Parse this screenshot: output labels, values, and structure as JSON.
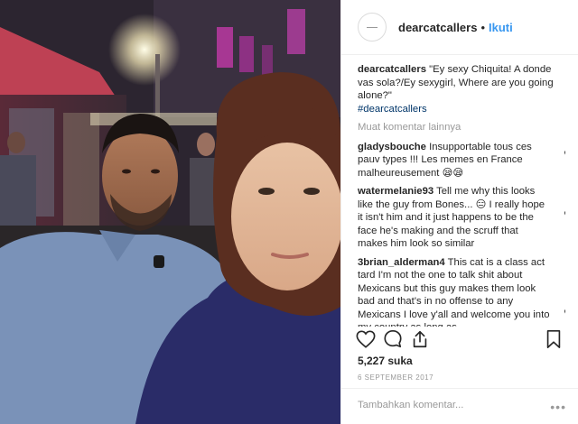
{
  "header": {
    "username": "dearcatcallers",
    "separator": "•",
    "follow_label": "Ikuti"
  },
  "caption": {
    "username": "dearcatcallers",
    "text": "\"Ey sexy Chiquita! A donde vas sola?/Ey sexygirl, Where are you going alone?\"",
    "hashtag": "#dearcatcallers"
  },
  "load_more_label": "Muat komentar lainnya",
  "comments": [
    {
      "username": "gladysbouche",
      "text": "Insupportable tous ces pauv types !!! Les memes en France malheureusement 😪😪"
    },
    {
      "username": "watermelanie93",
      "text": "Tell me why this looks like the guy from Bones... 😑 I really hope it isn't him and it just happens to be the face he's making and the scruff that makes him look so similar"
    },
    {
      "username": "3brian_alderman4",
      "text": "This cat is a class act tard I'm not the one to talk shit about Mexicans but this guy makes them look bad and that's in no offense to any Mexicans I love y'all and welcome you into my country as long as"
    }
  ],
  "icons": {
    "like": "heart-icon",
    "comment": "comment-icon",
    "share": "share-icon",
    "save": "bookmark-icon"
  },
  "likes_text": "5,227 suka",
  "date_text": "6 SEPTEMBER 2017",
  "add_comment": {
    "placeholder": "Tambahkan komentar...",
    "more_label": "•••"
  },
  "colors": {
    "link_blue": "#3897f0",
    "hashtag_blue": "#003569",
    "muted": "#999999"
  }
}
